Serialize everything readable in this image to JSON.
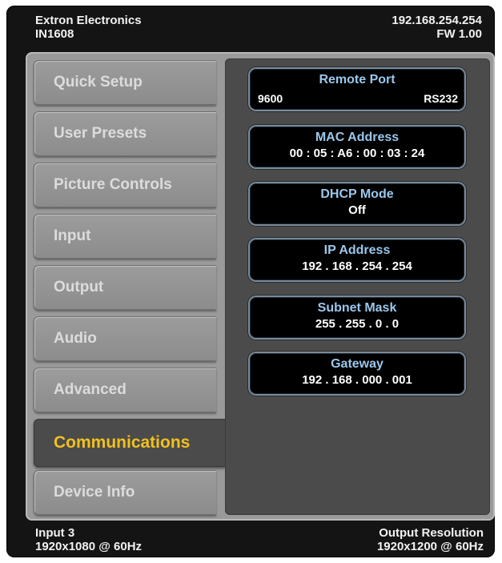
{
  "header": {
    "brand": "Extron Electronics",
    "model": "IN1608",
    "ip": "192.168.254.254",
    "firmware": "FW 1.00"
  },
  "menu": {
    "items": [
      {
        "label": "Quick Setup"
      },
      {
        "label": "User Presets"
      },
      {
        "label": "Picture Controls"
      },
      {
        "label": "Input"
      },
      {
        "label": "Output"
      },
      {
        "label": "Audio"
      },
      {
        "label": "Advanced"
      },
      {
        "label": "Communications"
      },
      {
        "label": "Device Info"
      }
    ],
    "active": "Communications"
  },
  "communications": {
    "remote_port": {
      "title": "Remote Port",
      "baud": "9600",
      "type": "RS232"
    },
    "mac_address": {
      "title": "MAC Address",
      "value": "00 : 05 : A6 : 00 : 03 : 24"
    },
    "dhcp_mode": {
      "title": "DHCP Mode",
      "value": "Off"
    },
    "ip_address": {
      "title": "IP Address",
      "value": "192 . 168 . 254 . 254"
    },
    "subnet_mask": {
      "title": "Subnet Mask",
      "value": "255 . 255 . 0 . 0"
    },
    "gateway": {
      "title": "Gateway",
      "value": "192 . 168 . 000 . 001"
    }
  },
  "footer": {
    "input_label": "Input 3",
    "input_res": "1920x1080 @ 60Hz",
    "output_label": "Output Resolution",
    "output_res": "1920x1200 @ 60Hz"
  },
  "colors": {
    "active_tab_text": "#f2c11d",
    "field_title": "#9bc7ec",
    "bezel": "#141414"
  }
}
